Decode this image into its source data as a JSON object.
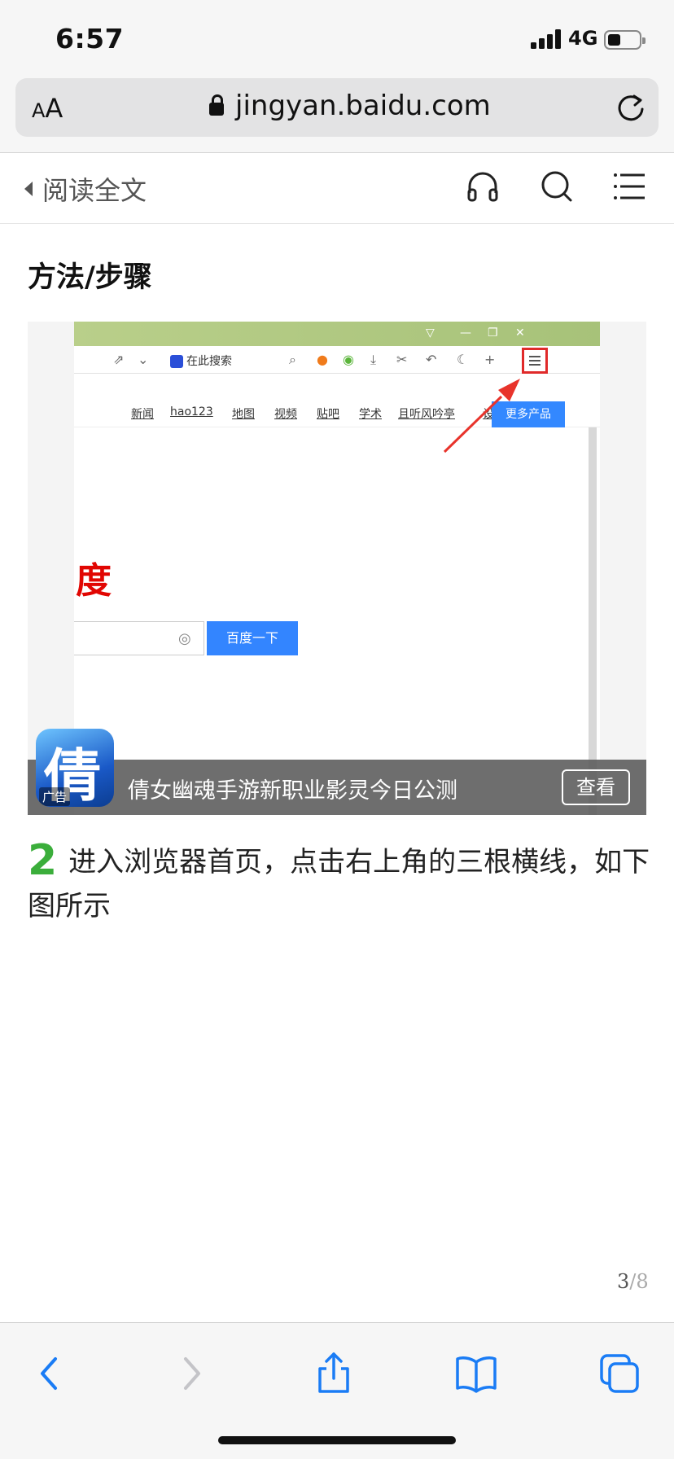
{
  "status": {
    "time": "6:57",
    "network": "4G"
  },
  "browser": {
    "text_size_label": "AA",
    "url": "jingyan.baidu.com"
  },
  "header": {
    "read_full_label": "阅读全文"
  },
  "content": {
    "section_title": "方法/步骤",
    "screenshot": {
      "search_placeholder": "在此搜索",
      "nav_links": [
        "新闻",
        "hao123",
        "地图",
        "视频",
        "贴吧",
        "学术",
        "且听风吟亭",
        "设置"
      ],
      "more_products": "更多产品",
      "logo_fragment": "度",
      "search_button": "百度一下"
    },
    "ad": {
      "text": "倩女幽魂手游新职业影灵今日公测",
      "button": "查看",
      "tag": "广告",
      "icon_glyph": "倩"
    },
    "step": {
      "number": "2",
      "text": "进入浏览器首页，点击右上角的三根横线，如下图所示"
    },
    "pager": {
      "current": "3",
      "total": "/8"
    }
  },
  "icons": {
    "header": [
      "headphones-icon",
      "search-icon",
      "menu-icon"
    ],
    "toolbar": [
      "back-icon",
      "forward-icon",
      "share-icon",
      "bookmarks-icon",
      "tabs-icon"
    ]
  },
  "colors": {
    "accent_blue": "#1a7cf5",
    "step_green": "#3bae3b",
    "highlight_red": "#e02a2a"
  }
}
